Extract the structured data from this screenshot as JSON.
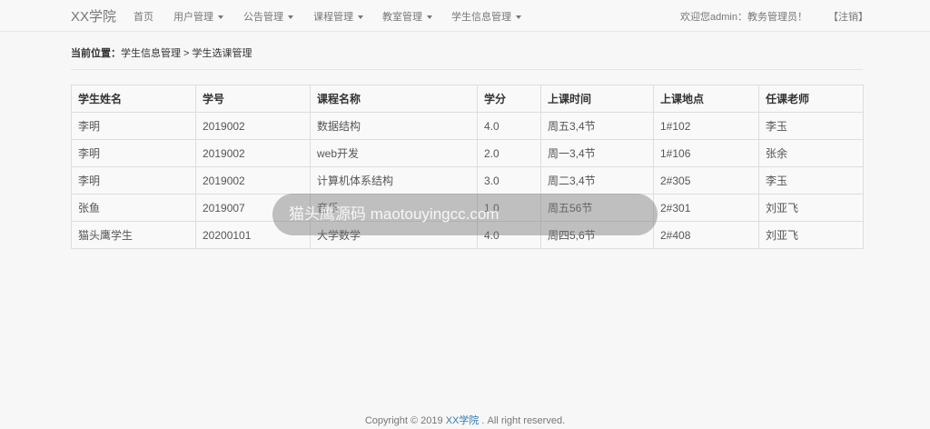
{
  "navbar": {
    "brand": "XX学院",
    "items": [
      {
        "label": "首页"
      },
      {
        "label": "用户管理"
      },
      {
        "label": "公告管理"
      },
      {
        "label": "课程管理"
      },
      {
        "label": "教室管理"
      },
      {
        "label": "学生信息管理"
      }
    ],
    "welcome": "欢迎您admin：教务管理员！",
    "logout": "【注销】"
  },
  "breadcrumb": {
    "label": "当前位置：",
    "path": "学生信息管理 > 学生选课管理"
  },
  "table": {
    "headers": [
      "学生姓名",
      "学号",
      "课程名称",
      "学分",
      "上课时间",
      "上课地点",
      "任课老师"
    ],
    "rows": [
      [
        "李明",
        "2019002",
        "数据结构",
        "4.0",
        "周五3,4节",
        "1#102",
        "李玉"
      ],
      [
        "李明",
        "2019002",
        "web开发",
        "2.0",
        "周一3,4节",
        "1#106",
        "张余"
      ],
      [
        "李明",
        "2019002",
        "计算机体系结构",
        "3.0",
        "周二3,4节",
        "2#305",
        "李玉"
      ],
      [
        "张鱼",
        "2019007",
        "音乐",
        "1.0",
        "周五56节",
        "2#301",
        "刘亚飞"
      ],
      [
        "猫头鹰学生",
        "20200101",
        "大学数学",
        "4.0",
        "周四5,6节",
        "2#408",
        "刘亚飞"
      ]
    ]
  },
  "watermark": "猫头鹰源码 maotouyingcc.com",
  "footer": {
    "prefix": "Copyright © 2019 ",
    "link": "XX学院",
    "suffix": " . All right reserved."
  }
}
